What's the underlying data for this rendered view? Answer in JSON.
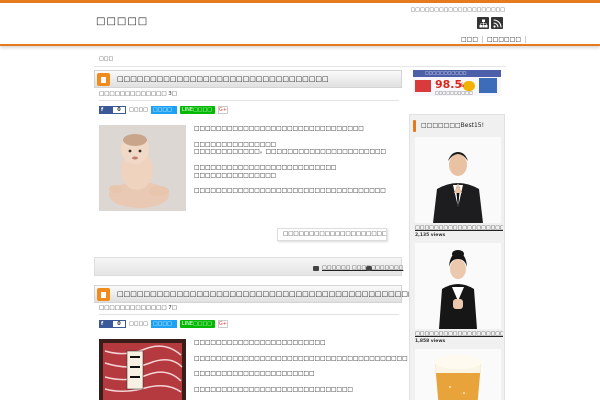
{
  "site": {
    "title": "□□□□□",
    "tagline": "□□□□□□□□□□□□□□□□□□□□"
  },
  "nav": [
    "□□□",
    "□□□□□□"
  ],
  "breadcrumb": "□□□",
  "posts": [
    {
      "title": "□□□□□□□□□□□□□□□□□□□□□□□□□□□□□□□□",
      "date": "□□□□□□□□□□□□□  3□",
      "social": {
        "fb_label": "□□□□",
        "fb_count": "0",
        "tw_label": "□□□□",
        "share_text": "□□□□",
        "line_label": "LINE□□□□",
        "gplus_label": "G+"
      },
      "body": [
        "□□□□□□□□□□□□□□□□□□□□□□□□□□□□□□□",
        "",
        "□□□□□□□□□□□□□□□",
        "□□□□□□□□□□□□。□□□□□□□□□□□□□□□□□□□□□□",
        "",
        "□□□□□□□□□□□□□□□□□□□□□□□□□□",
        "□□□□□□□□□□□□□□□",
        "",
        "□□□□□□□□□□□□□□□□□□□□□□□□□□□□□□□□□□□"
      ],
      "more": "□□□□□□□□□□□□□□□□□□□□□□□□□□□□□□□□□□□□□□□□ »",
      "category": "□□□□□□ □□□□□",
      "comments": "□□□□□□"
    },
    {
      "title": "□□□□□□□□□□□□□□□□□□□□□□□□□□□□□□□□□□□□□□□□□□□□□□□□□□□□□□□",
      "date": "□□□□□□□□□□□□□  7□",
      "social": {
        "fb_label": "□□□□",
        "fb_count": "0",
        "tw_label": "□□□□",
        "share_text": "□□□□",
        "line_label": "LINE□□□□",
        "gplus_label": "G+"
      },
      "body": [
        "□□□□□□□□□□□□□□□□□□□□□□□□",
        "",
        "□□□□□□□□□□□□□□□□□□□□□□□□□□□□□□□□□□□□□□□",
        "",
        "□□□□□□□□□□□□□□□□□□□□□□",
        "",
        "□□□□□□□□□□□□□□□□□□□□□□□□□□□□□"
      ]
    }
  ],
  "sidebar": {
    "banner": {
      "brand": "□□□□□□□□□□□",
      "percent": "98.5",
      "unit": "%",
      "text": "□□□□□□□□□□"
    },
    "ranking": {
      "title": "□□□□□□□Best15!",
      "items": [
        {
          "title": "□□□□□□□□□□□□□□□□□□□□□□□□□□□□□□□□□□□□□□□□□□",
          "views": "2,135 views"
        },
        {
          "title": "□□□□□□□□□□□□□□□□□□□□□□□□□□□□□□□□□□□□□□□□□□□□□□□",
          "views": "1,858 views"
        },
        {
          "title": "",
          "views": ""
        }
      ]
    }
  },
  "colors": {
    "accent": "#e67a1e",
    "facebook": "#3b5998",
    "twitter": "#1da1f2",
    "line": "#00b900"
  }
}
